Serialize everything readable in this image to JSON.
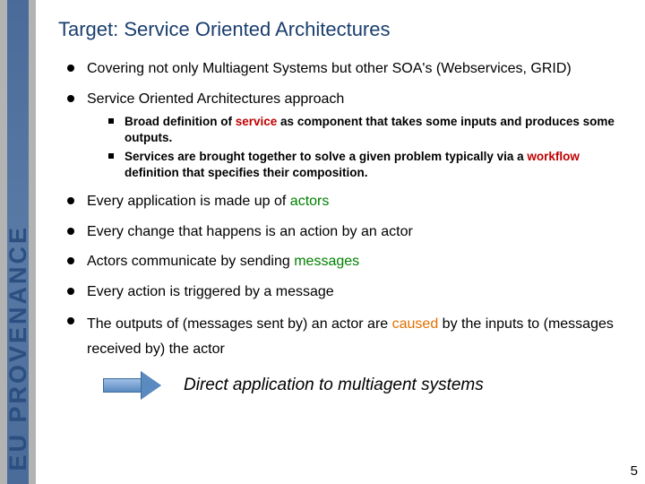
{
  "sidebar": {
    "label": "EU PROVENANCE"
  },
  "title": "Target: Service Oriented Architectures",
  "bullets": {
    "b1": {
      "text": "Covering not only Multiagent Systems but other SOA's (Webservices, GRID)"
    },
    "b2": {
      "text": "Service Oriented Architectures approach",
      "sub1_a": "Broad definition of ",
      "sub1_hl": "service",
      "sub1_b": " as component that takes some inputs and produces some outputs.",
      "sub2_a": "Services are brought together to solve a given problem typically via a  ",
      "sub2_hl": "workflow",
      "sub2_b": " definition that specifies their composition."
    },
    "b3": {
      "a": "Every application is made up of ",
      "hl": "actors"
    },
    "b4": {
      "text": "Every change that happens is an action by an actor"
    },
    "b5": {
      "a": "Actors communicate by sending ",
      "hl": "messages"
    },
    "b6": {
      "text": "Every action is triggered by a message"
    },
    "b7": {
      "a": "The outputs of (messages sent by) an actor are ",
      "hl": "caused",
      "b": " by the inputs to (messages received by) the actor"
    }
  },
  "conclusion": "Direct application to multiagent systems",
  "page_number": "5"
}
